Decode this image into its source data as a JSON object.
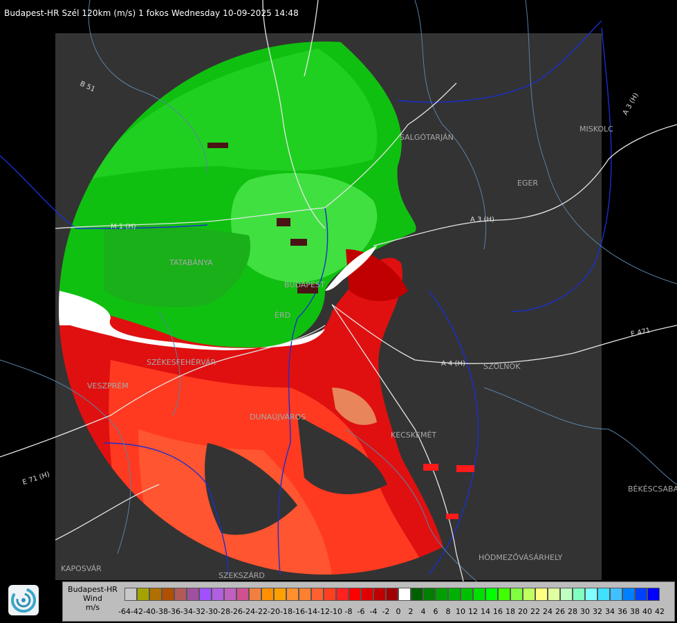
{
  "header": {
    "title": "Budapest-HR Szél 120km (m/s) 1 fokos Wednesday 10-09-2025 14:48"
  },
  "map": {
    "cities": [
      {
        "id": "salgotarjan",
        "label": "SALGÓTARJÁN"
      },
      {
        "id": "miskolc",
        "label": "MISKOLC"
      },
      {
        "id": "eger",
        "label": "EGER"
      },
      {
        "id": "tatabanya",
        "label": "TATABÁNYA"
      },
      {
        "id": "budapest",
        "label": "BUDAPEST"
      },
      {
        "id": "erd",
        "label": "ÉRD"
      },
      {
        "id": "szekesfehervar",
        "label": "SZÉKESFEHÉRVÁR"
      },
      {
        "id": "veszprem",
        "label": "VESZPRÉM"
      },
      {
        "id": "szolnok",
        "label": "SZOLNOK"
      },
      {
        "id": "dunaujvaros",
        "label": "DUNAÚJVÁROS"
      },
      {
        "id": "kecskemet",
        "label": "KECSKEMÉT"
      },
      {
        "id": "bekescsaba",
        "label": "BÉKÉSCSABA"
      },
      {
        "id": "hodmezovasarhely",
        "label": "HÓDMEZŐVÁSÁRHELY"
      },
      {
        "id": "kaposvar",
        "label": "KAPOSVÁR"
      },
      {
        "id": "szekszard",
        "label": "SZEKSZÁRD"
      }
    ],
    "roads": [
      {
        "id": "b51",
        "label": "B 51"
      },
      {
        "id": "m1",
        "label": "M 1 (H)"
      },
      {
        "id": "a3",
        "label": "A 3 (H)"
      },
      {
        "id": "a3ne",
        "label": "A 3 (H)"
      },
      {
        "id": "a4",
        "label": "A 4 (H)"
      },
      {
        "id": "e471",
        "label": "E 471"
      },
      {
        "id": "e71",
        "label": "E 71 (H)"
      }
    ]
  },
  "legend": {
    "station": "Budapest-HR",
    "quantity": "Wind",
    "unit": "m/s",
    "ticks": [
      "-64",
      "-42",
      "-40",
      "-38",
      "-36",
      "-34",
      "-32",
      "-30",
      "-28",
      "-26",
      "-24",
      "-22",
      "-20",
      "-18",
      "-16",
      "-14",
      "-12",
      "-10",
      "-8",
      "-6",
      "-4",
      "-2",
      "0",
      "2",
      "4",
      "6",
      "8",
      "10",
      "12",
      "14",
      "16",
      "18",
      "20",
      "22",
      "24",
      "26",
      "28",
      "30",
      "32",
      "34",
      "36",
      "38",
      "40",
      "42"
    ],
    "colors": [
      "#c8c8c8",
      "#a4a400",
      "#b07000",
      "#b05000",
      "#b05a5a",
      "#a050a0",
      "#a050ff",
      "#b060e0",
      "#c060c0",
      "#d05090",
      "#f08040",
      "#ff9000",
      "#ffa000",
      "#ff9030",
      "#ff8030",
      "#ff6030",
      "#ff4020",
      "#ff2020",
      "#ff0000",
      "#e00000",
      "#c00000",
      "#a00000",
      "#ffffff",
      "#006000",
      "#008000",
      "#00a000",
      "#00b000",
      "#00c000",
      "#00e000",
      "#00ff00",
      "#40ff00",
      "#80ff40",
      "#c0ff60",
      "#ffff80",
      "#e0ffa0",
      "#c0ffc0",
      "#80ffc0",
      "#80ffff",
      "#40e0ff",
      "#40c0ff",
      "#0080ff",
      "#0040ff",
      "#0000ff"
    ]
  }
}
